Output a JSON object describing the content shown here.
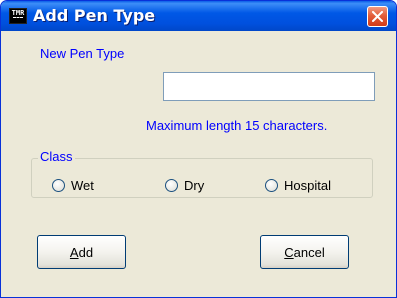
{
  "window": {
    "title": "Add Pen Type",
    "icon_name": "tmr-app-icon",
    "icon_text": "TMR",
    "close_icon": "close-icon"
  },
  "form": {
    "new_pen_label": "New Pen Type",
    "new_pen_value": "",
    "max_length_note": "Maximum length 15 characters."
  },
  "class_group": {
    "legend": "Class",
    "options": [
      {
        "label": "Wet",
        "checked": false
      },
      {
        "label": "Dry",
        "checked": false
      },
      {
        "label": "Hospital",
        "checked": false
      }
    ]
  },
  "buttons": {
    "add": {
      "mnemonic": "A",
      "rest": "dd"
    },
    "cancel": {
      "mnemonic": "C",
      "rest": "ancel"
    }
  },
  "colors": {
    "titlebar": "#0058e6",
    "label_text": "#0000ff",
    "dialog_bg": "#ece9d8",
    "close_button": "#d23a18"
  }
}
